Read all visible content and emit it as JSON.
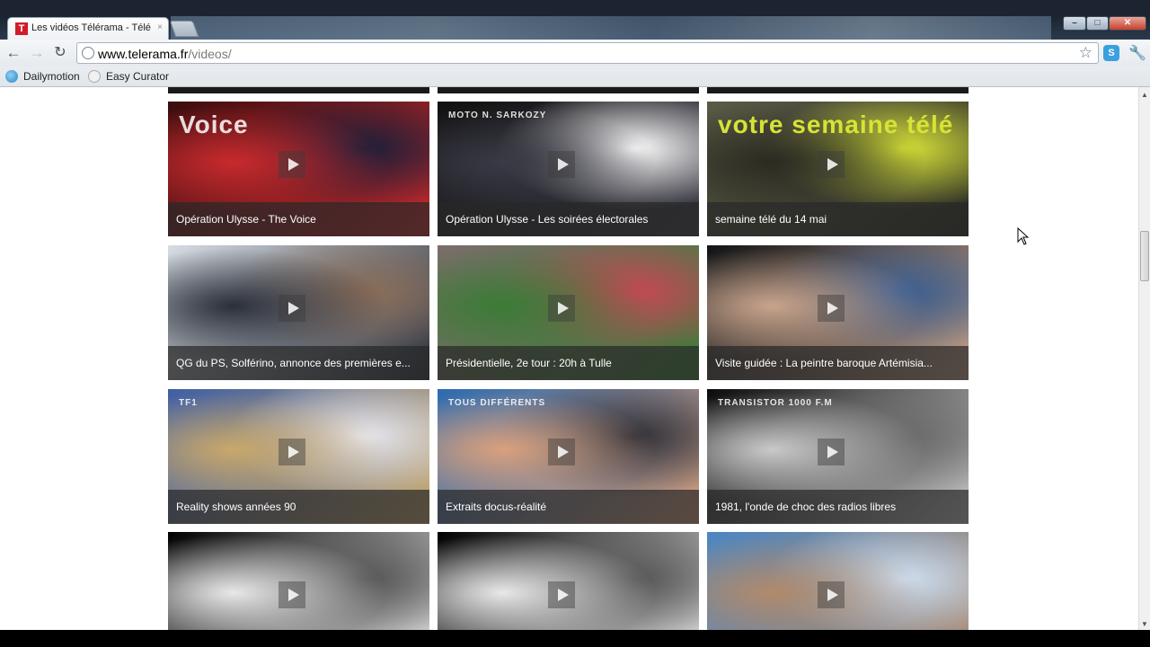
{
  "browser": {
    "tab_title": "Les vidéos Télérama - Télé",
    "tab_close": "×",
    "favicon_letter": "T",
    "url_host": "www.telerama.fr",
    "url_path": "/videos/",
    "bookmarks": [
      "Dailymotion",
      "Easy Curator"
    ],
    "ext_icon": "S",
    "icons": {
      "back": "back-arrow-icon",
      "forward": "forward-arrow-icon",
      "reload": "reload-icon",
      "star": "star-icon",
      "wrench": "wrench-icon"
    },
    "window_buttons": {
      "minimize": "–",
      "maximize": "□",
      "close": "✕"
    }
  },
  "videos": [
    {
      "title": "Opération Ulysse - The Voice",
      "palette": [
        "#3a0d0f",
        "#c72a2d",
        "#1a1f3a"
      ],
      "overlay": "Voice"
    },
    {
      "title": "Opération Ulysse - Les soirées électorales",
      "palette": [
        "#111",
        "#3a3a46",
        "#ffffff"
      ],
      "overlay": "MOTO N. SARKOZY"
    },
    {
      "title": "semaine télé du 14 mai",
      "palette": [
        "#5a5b46",
        "#2b2b22",
        "#d7e336"
      ],
      "overlay": "votre semaine télé"
    },
    {
      "title": "QG du PS, Solférino, annonce des premières e...",
      "palette": [
        "#d7dde3",
        "#2a2f3a",
        "#8a6d58"
      ],
      "overlay": ""
    },
    {
      "title": "Présidentielle, 2e tour : 20h à Tulle",
      "palette": [
        "#7b6d6a",
        "#3c7b36",
        "#c94655"
      ],
      "overlay": ""
    },
    {
      "title": "Visite guidée : La peintre baroque Artémisia...",
      "palette": [
        "#111316",
        "#c8a48c",
        "#3b5f93"
      ],
      "overlay": ""
    },
    {
      "title": "Reality shows années 90",
      "palette": [
        "#3f5fa5",
        "#c9a86a",
        "#e7e7ef"
      ],
      "overlay": "TF1"
    },
    {
      "title": "Extraits docus-réalité",
      "palette": [
        "#2c6bb0",
        "#d9a07c",
        "#2f2f36"
      ],
      "overlay": "TOUS DIFFÉRENTS"
    },
    {
      "title": "1981, l'onde de choc des radios libres",
      "palette": [
        "#0b0b0b",
        "#c9c9c9",
        "#6a6a6a"
      ],
      "overlay": "TRANSISTOR 1000 F.M"
    },
    {
      "title": "",
      "palette": [
        "#000",
        "#e8e8e8",
        "#555"
      ],
      "overlay": ""
    },
    {
      "title": "",
      "palette": [
        "#000",
        "#e8e8e8",
        "#555"
      ],
      "overlay": ""
    },
    {
      "title": "",
      "palette": [
        "#4c86c2",
        "#b08a6b",
        "#cfdff0"
      ],
      "overlay": ""
    }
  ]
}
